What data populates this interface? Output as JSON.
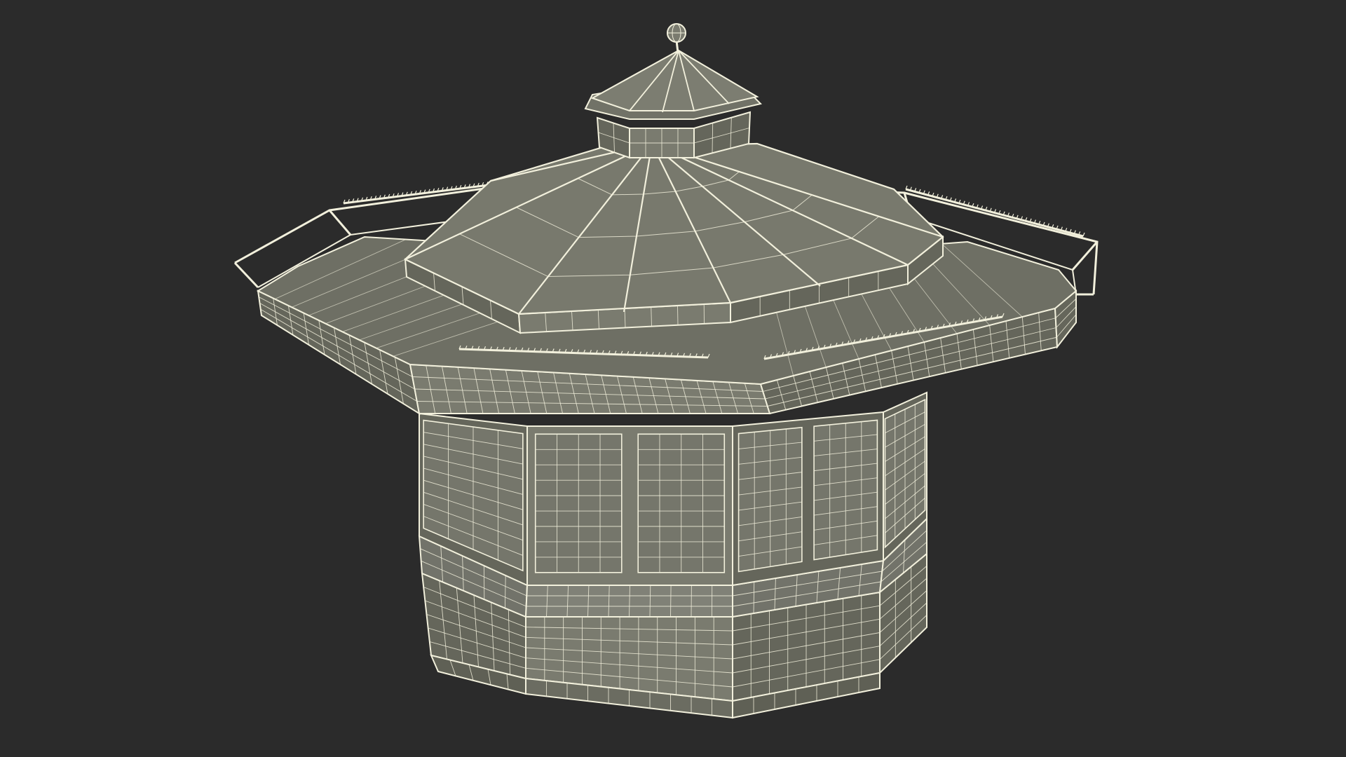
{
  "scene": {
    "subject": "octagonal-kiosk-wireframe",
    "background_color": "#2b2b2b",
    "surface_color": "#7a7b6f",
    "surface_dark_color": "#65665b",
    "wire_color": "#f2f0dc"
  }
}
